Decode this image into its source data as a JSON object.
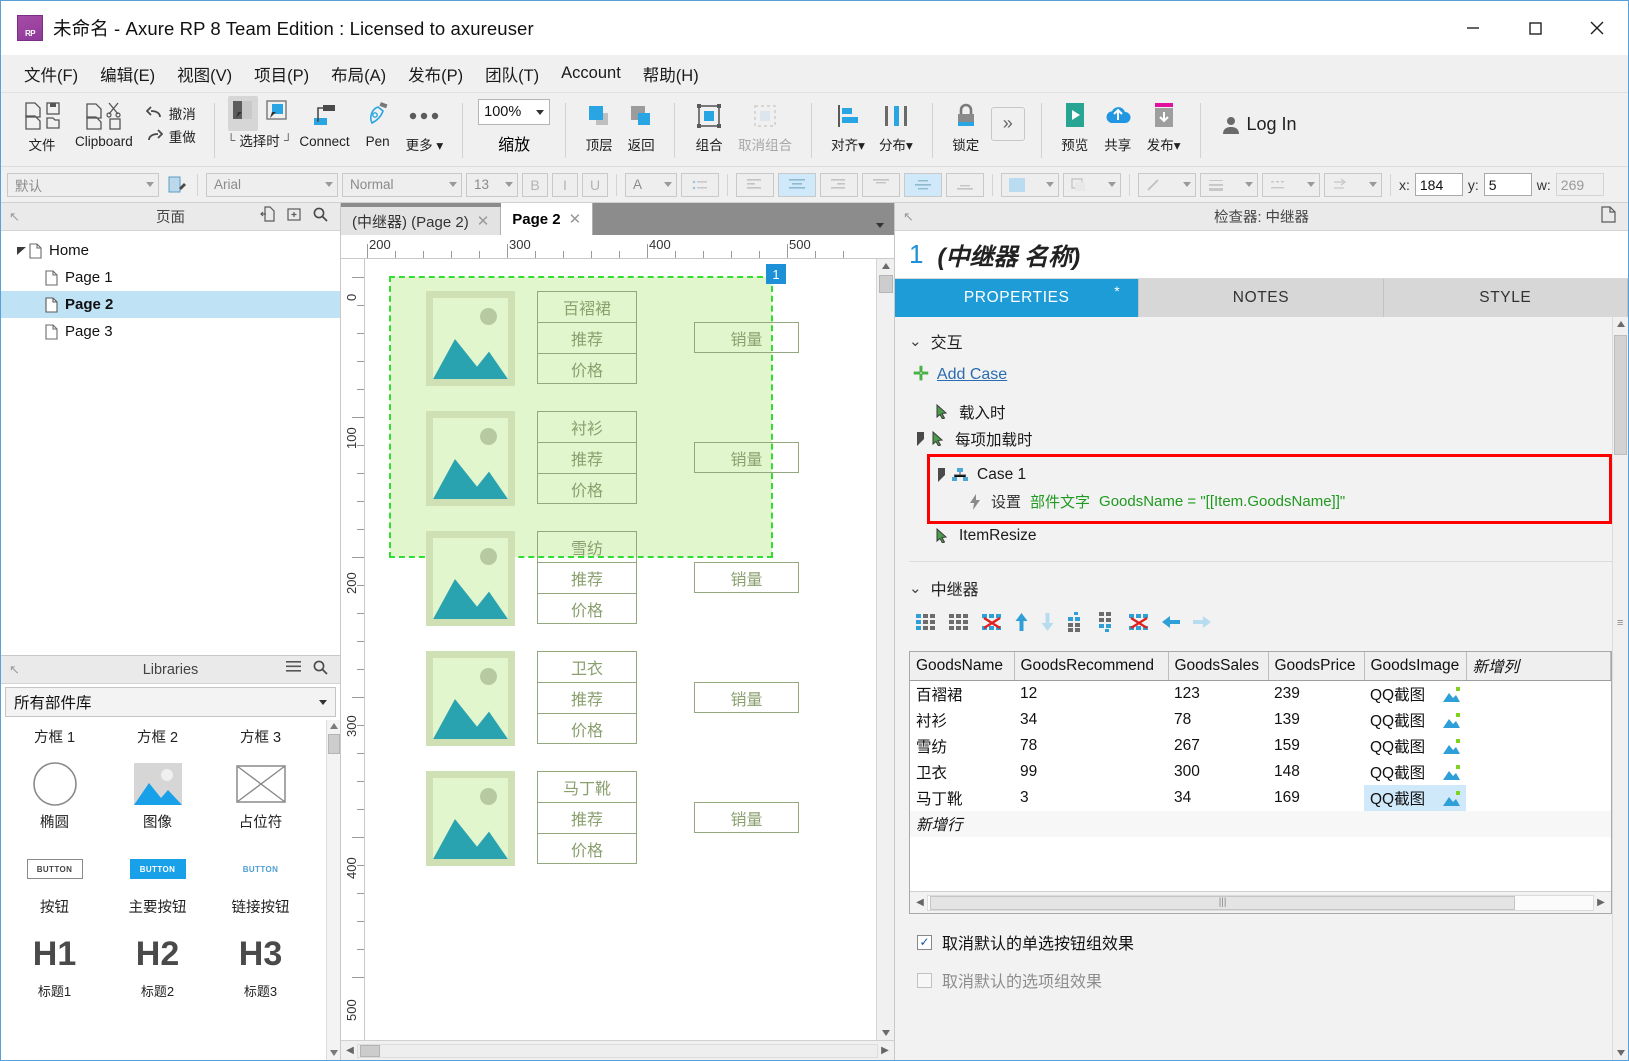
{
  "window": {
    "title": "未命名 - Axure RP 8 Team Edition : Licensed to axureuser",
    "app_badge": "RP",
    "minimize": "–",
    "maximize": "□",
    "close": "✕"
  },
  "menubar": {
    "items": [
      {
        "label": "文件(F)",
        "key": "F"
      },
      {
        "label": "编辑(E)",
        "key": "E"
      },
      {
        "label": "视图(V)",
        "key": "V"
      },
      {
        "label": "项目(P)",
        "key": "P"
      },
      {
        "label": "布局(A)",
        "key": "A"
      },
      {
        "label": "发布(P)",
        "key": "P"
      },
      {
        "label": "团队(T)",
        "key": "T"
      },
      {
        "label": "Account",
        "key": "A"
      },
      {
        "label": "帮助(H)",
        "key": "H"
      }
    ]
  },
  "ribbon": {
    "file_label": "文件",
    "clipboard_label": "Clipboard",
    "undo_label": "撤消",
    "redo_label": "重做",
    "select_caption": "选择时",
    "connect_label": "Connect",
    "pen_label": "Pen",
    "more_label": "更多",
    "zoom_value": "100%",
    "zoom_label": "缩放",
    "top_label": "顶层",
    "back_label": "返回",
    "group_label": "组合",
    "ungroup_label": "取消组合",
    "align_label": "对齐",
    "distribute_label": "分布",
    "lock_label": "锁定",
    "overflow_label": "»",
    "preview_label": "预览",
    "share_label": "共享",
    "publish_label": "发布",
    "login_label": "Log In"
  },
  "stylebar": {
    "style_value": "默认",
    "font_value": "Arial",
    "weight_value": "Normal",
    "size_value": "13",
    "bold": "B",
    "italic": "I",
    "underline": "U",
    "fontcolor": "A",
    "x_label": "x:",
    "x_value": "184",
    "y_label": "y:",
    "y_value": "5",
    "w_label": "w:",
    "w_value": "269"
  },
  "pages_panel": {
    "title": "页面",
    "tree": [
      {
        "label": "Home",
        "level": 0,
        "selected": false,
        "expanded": true
      },
      {
        "label": "Page 1",
        "level": 1,
        "selected": false
      },
      {
        "label": "Page 2",
        "level": 1,
        "selected": true
      },
      {
        "label": "Page 3",
        "level": 1,
        "selected": false
      }
    ]
  },
  "libraries_panel": {
    "title": "Libraries",
    "selected_library": "所有部件库",
    "items": [
      {
        "label": "方框 1",
        "icon": "box1-icon"
      },
      {
        "label": "方框 2",
        "icon": "box2-icon"
      },
      {
        "label": "方框 3",
        "icon": "box3-icon"
      },
      {
        "label": "椭圆",
        "icon": "ellipse-icon"
      },
      {
        "label": "图像",
        "icon": "image-icon"
      },
      {
        "label": "占位符",
        "icon": "placeholder-icon"
      },
      {
        "label": "按钮",
        "icon": "button-icon",
        "glyph": "BUTTON"
      },
      {
        "label": "主要按钮",
        "icon": "primary-button-icon",
        "glyph": "BUTTON"
      },
      {
        "label": "链接按钮",
        "icon": "link-button-icon",
        "glyph": "BUTTON"
      },
      {
        "label": "标题1",
        "icon": "h1-icon",
        "glyph": "H1"
      },
      {
        "label": "标题2",
        "icon": "h2-icon",
        "glyph": "H2"
      },
      {
        "label": "标题3",
        "icon": "h3-icon",
        "glyph": "H3"
      }
    ]
  },
  "canvas": {
    "tabs": [
      {
        "label": "(中继器) (Page 2)",
        "active": false
      },
      {
        "label": "Page 2",
        "active": true
      }
    ],
    "ruler_h_labels": [
      "200",
      "300",
      "400",
      "500"
    ],
    "ruler_v_labels": [
      "0",
      "100",
      "200",
      "300",
      "400",
      "500"
    ],
    "repeater_badge": "1",
    "items": [
      {
        "name": "百褶裙",
        "recommend": "推荐",
        "price": "价格",
        "sales": "销量"
      },
      {
        "name": "衬衫",
        "recommend": "推荐",
        "price": "价格",
        "sales": "销量"
      },
      {
        "name": "雪纺",
        "recommend": "推荐",
        "price": "价格",
        "sales": "销量"
      },
      {
        "name": "卫衣",
        "recommend": "推荐",
        "price": "价格",
        "sales": "销量"
      },
      {
        "name": "马丁靴",
        "recommend": "推荐",
        "price": "价格",
        "sales": "销量"
      }
    ],
    "colors": {
      "repeater_bg": "#e2f6cd",
      "selection_outline": "#33dd33",
      "image_frame": "#cfe0b4",
      "image_art": "#2aa3b0",
      "text_border": "#93a87d",
      "text_color": "#8aa06f",
      "badge_bg": "#1e90d8"
    }
  },
  "inspector": {
    "header": "检查器: 中继器",
    "widget_number": "1",
    "widget_name": "(中继器 名称)",
    "tabs": [
      {
        "label": "PROPERTIES",
        "active": true,
        "marker": "*"
      },
      {
        "label": "NOTES",
        "active": false
      },
      {
        "label": "STYLE",
        "active": false
      }
    ],
    "interactions": {
      "section_title": "交互",
      "add_case": "Add Case",
      "events": [
        {
          "label": "载入时",
          "level": 1,
          "expandable": false
        },
        {
          "label": "每项加载时",
          "level": 1,
          "expandable": true
        },
        {
          "label": "Case 1",
          "level": 2,
          "expandable": true,
          "highlighted": true
        },
        {
          "label": "ItemResize",
          "level": 1,
          "expandable": false
        }
      ],
      "action": {
        "verb": "设置",
        "target": "部件文字",
        "expression": "GoodsName = \"[[Item.GoodsName]]\""
      }
    },
    "repeater": {
      "section_title": "中继器",
      "toolbar_icons": [
        "add-column-left-icon",
        "add-column-right-icon",
        "delete-column-icon",
        "move-up-icon",
        "move-down-icon",
        "add-row-above-icon",
        "add-row-below-icon",
        "delete-row-icon",
        "move-left-icon",
        "move-right-icon"
      ],
      "columns": [
        "GoodsName",
        "GoodsRecommend",
        "GoodsSales",
        "GoodsPrice",
        "GoodsImage",
        "新增列"
      ],
      "rows": [
        {
          "GoodsName": "百褶裙",
          "GoodsRecommend": "12",
          "GoodsSales": "123",
          "GoodsPrice": "239",
          "GoodsImage": "QQ截图",
          "selected": false
        },
        {
          "GoodsName": "衬衫",
          "GoodsRecommend": "34",
          "GoodsSales": "78",
          "GoodsPrice": "139",
          "GoodsImage": "QQ截图",
          "selected": false
        },
        {
          "GoodsName": "雪纺",
          "GoodsRecommend": "78",
          "GoodsSales": "267",
          "GoodsPrice": "159",
          "GoodsImage": "QQ截图",
          "selected": false
        },
        {
          "GoodsName": "卫衣",
          "GoodsRecommend": "99",
          "GoodsSales": "300",
          "GoodsPrice": "148",
          "GoodsImage": "QQ截图",
          "selected": false
        },
        {
          "GoodsName": "马丁靴",
          "GoodsRecommend": "3",
          "GoodsSales": "34",
          "GoodsPrice": "169",
          "GoodsImage": "QQ截图",
          "selected": true
        }
      ],
      "new_row_label": "新增行"
    },
    "options": [
      {
        "label": "取消默认的单选按钮组效果",
        "checked": true
      },
      {
        "label": "取消默认的选项组效果",
        "checked": false
      }
    ]
  }
}
